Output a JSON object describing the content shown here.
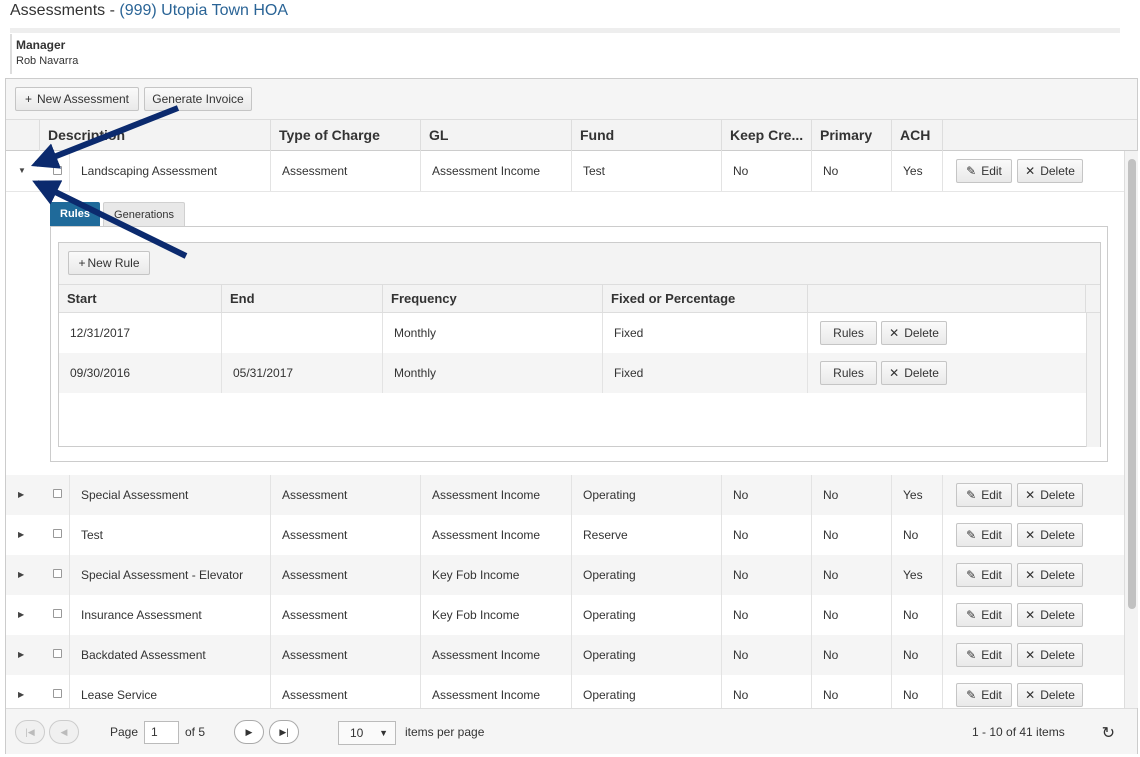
{
  "page": {
    "title_prefix": "Assessments - ",
    "association": "(999) Utopia Town HOA"
  },
  "manager": {
    "label": "Manager",
    "name": "Rob Navarra"
  },
  "toolbar": {
    "new_assessment": "New Assessment",
    "generate_invoice": "Generate Invoice"
  },
  "columns": [
    "Description",
    "Type of Charge",
    "GL",
    "Fund",
    "Keep Cre...",
    "Primary",
    "ACH"
  ],
  "rows": [
    {
      "description": "Landscaping Assessment",
      "type": "Assessment",
      "gl": "Assessment Income",
      "fund": "Test",
      "keep_credit": "No",
      "primary": "No",
      "ach": "Yes",
      "expanded": true
    },
    {
      "description": "Special Assessment",
      "type": "Assessment",
      "gl": "Assessment Income",
      "fund": "Operating",
      "keep_credit": "No",
      "primary": "No",
      "ach": "Yes"
    },
    {
      "description": "Test",
      "type": "Assessment",
      "gl": "Assessment Income",
      "fund": "Reserve",
      "keep_credit": "No",
      "primary": "No",
      "ach": "No"
    },
    {
      "description": "Special Assessment - Elevator",
      "type": "Assessment",
      "gl": "Key Fob Income",
      "fund": "Operating",
      "keep_credit": "No",
      "primary": "No",
      "ach": "Yes"
    },
    {
      "description": "Insurance Assessment",
      "type": "Assessment",
      "gl": "Key Fob Income",
      "fund": "Operating",
      "keep_credit": "No",
      "primary": "No",
      "ach": "No"
    },
    {
      "description": "Backdated Assessment",
      "type": "Assessment",
      "gl": "Assessment Income",
      "fund": "Operating",
      "keep_credit": "No",
      "primary": "No",
      "ach": "No"
    },
    {
      "description": "Lease Service",
      "type": "Assessment",
      "gl": "Assessment Income",
      "fund": "Operating",
      "keep_credit": "No",
      "primary": "No",
      "ach": "No"
    }
  ],
  "row_actions": {
    "edit": "Edit",
    "delete": "Delete"
  },
  "detail": {
    "tabs": [
      {
        "label": "Rules",
        "active": true
      },
      {
        "label": "Generations",
        "active": false
      }
    ],
    "new_rule": "New Rule",
    "columns": [
      "Start",
      "End",
      "Frequency",
      "Fixed or Percentage"
    ],
    "rules": [
      {
        "start": "12/31/2017",
        "end": "",
        "frequency": "Monthly",
        "fixed": "Fixed"
      },
      {
        "start": "09/30/2016",
        "end": "05/31/2017",
        "frequency": "Monthly",
        "fixed": "Fixed"
      }
    ],
    "rule_actions": {
      "rules": "Rules",
      "delete": "Delete"
    }
  },
  "pager": {
    "page_label": "Page",
    "page": "1",
    "of_label": "of 5",
    "page_size": "10",
    "per_page_label": "items per page",
    "summary": "1 - 10 of 41 items"
  },
  "icons": {
    "plus": "plus-icon",
    "pencil": "pencil-icon",
    "close": "close-icon",
    "caret_down": "caret-down-icon",
    "caret_right": "caret-right-icon",
    "refresh": "refresh-icon"
  },
  "colors": {
    "accent": "#1f6a9a",
    "link": "#2a6496",
    "annotation_arrow": "#0b2a6e"
  }
}
